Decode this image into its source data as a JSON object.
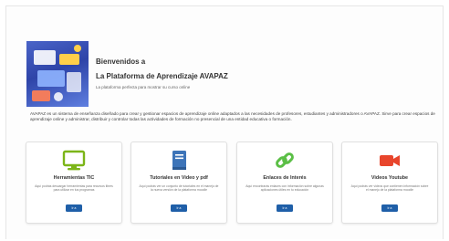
{
  "hero": {
    "welcome": "Bienvenidos a",
    "title": "La Plataforma de Aprendizaje AVAPAZ",
    "subtitle": "La plataforma perfecta para mostrar su curso online",
    "description": "AVAPAZ es un sistema de enseñanza diseñado para crear y gestionar espacios de aprendizaje online adaptados a las necesidades de profesores, estudiantes y administradores o AVAPAZ. Sirve para crear espacios de aprendizaje online y administrar, distribuir y controlar todas las actividades de formación no presencial de una entidad educativa o formación."
  },
  "cards": [
    {
      "title": "Herramientas TIC",
      "description": "Aquí podrás descargar herramientas para recursos libres para utilizar en tus programas",
      "button": "Ir a",
      "icon": "monitor-icon",
      "color": "#7cb518"
    },
    {
      "title": "Tutoriales en Video y pdf",
      "description": "Aquí podrás ver un conjunto de tutoriales en el manejo de la nueva versión de la plataforma moodle",
      "button": "Ir a",
      "icon": "book-icon",
      "color": "#3d74b8"
    },
    {
      "title": "Enlaces de Interés",
      "description": "Aquí encontrarás enlaces con información sobre algunas aplicaciones útiles en tu educación",
      "button": "Ir a",
      "icon": "link-icon",
      "color": "#5bbf46"
    },
    {
      "title": "Videos Youtube",
      "description": "Aquí podrás ver videos que contienen información sobre el manejo de la plataforma moodle",
      "button": "Ir a",
      "icon": "video-camera-icon",
      "color": "#e8452c"
    }
  ]
}
